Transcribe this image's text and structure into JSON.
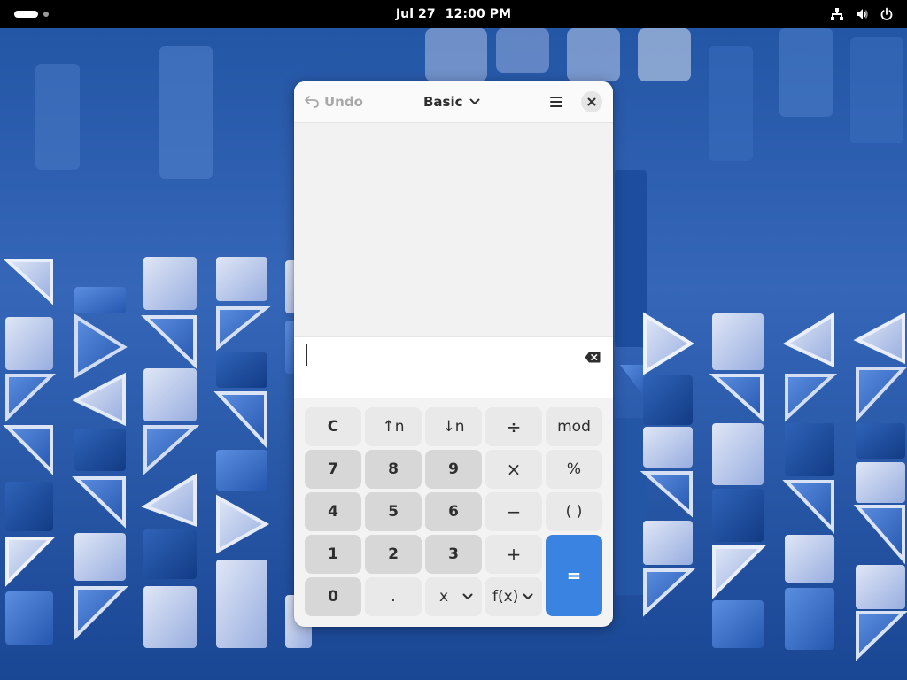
{
  "topbar": {
    "date": "Jul 27",
    "time": "12:00 PM",
    "icons": [
      "activities-indicator",
      "network-icon",
      "volume-icon",
      "power-icon"
    ]
  },
  "window": {
    "undo_label": "Undo",
    "mode_label": "Basic",
    "entry_value": "",
    "accent_color": "#3b83e0"
  },
  "keypad": {
    "rows": [
      [
        "C",
        "↑n",
        "↓n",
        "÷",
        "mod"
      ],
      [
        "7",
        "8",
        "9",
        "×",
        "%"
      ],
      [
        "4",
        "5",
        "6",
        "−",
        "( )"
      ],
      [
        "1",
        "2",
        "3",
        "+",
        "="
      ],
      [
        "0",
        ".",
        "x",
        "f(x)"
      ]
    ]
  }
}
